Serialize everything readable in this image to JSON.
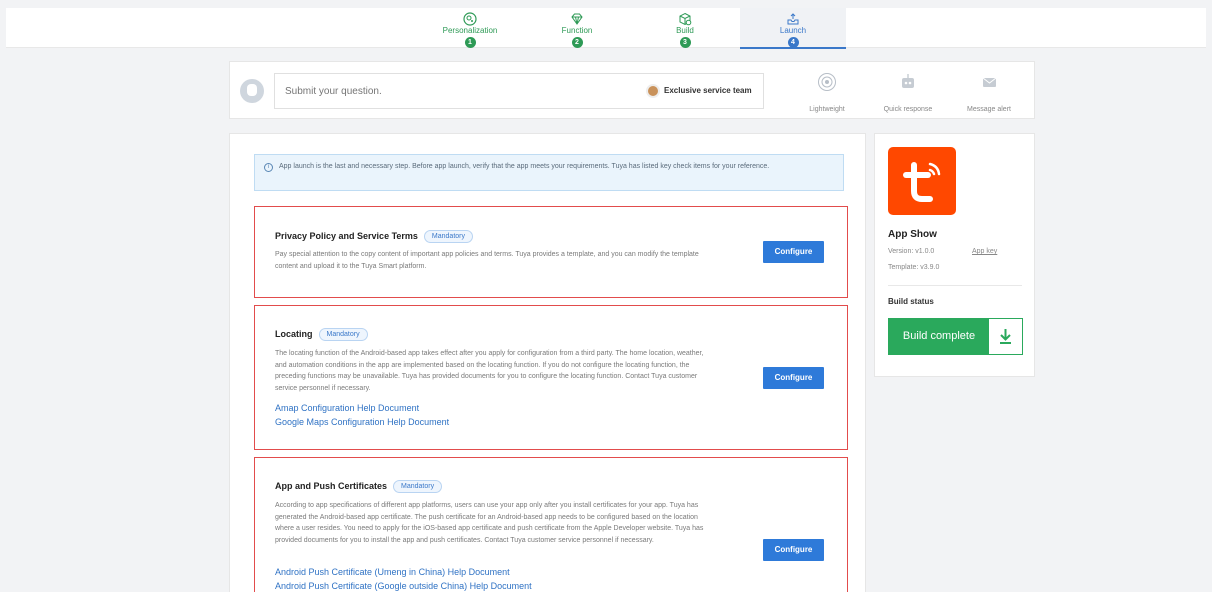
{
  "stepper": {
    "steps": [
      {
        "label": "Personalization",
        "number": "1",
        "icon": "palette-icon",
        "state": "done"
      },
      {
        "label": "Function",
        "number": "2",
        "icon": "diamond-icon",
        "state": "done"
      },
      {
        "label": "Build",
        "number": "3",
        "icon": "cube-icon",
        "state": "done"
      },
      {
        "label": "Launch",
        "number": "4",
        "icon": "inbox-upload-icon",
        "state": "active"
      }
    ]
  },
  "question_bar": {
    "placeholder": "Submit your question.",
    "exclusive_label": "Exclusive service team",
    "features": [
      {
        "label": "Lightweight",
        "icon": "target-icon"
      },
      {
        "label": "Quick response",
        "icon": "robot-icon"
      },
      {
        "label": "Message alert",
        "icon": "mail-icon"
      }
    ]
  },
  "notice": {
    "text": "App launch is the last and necessary step. Before app launch, verify that the app meets your requirements. Tuya has listed key check items for your reference."
  },
  "cards": [
    {
      "title": "Privacy Policy and Service Terms",
      "badge": "Mandatory",
      "description": "Pay special attention to the copy content of important app policies and terms. Tuya provides a template, and you can modify the template content and upload it to the Tuya Smart platform.",
      "button": "Configure",
      "links": []
    },
    {
      "title": "Locating",
      "badge": "Mandatory",
      "description": "The locating function of the Android-based app takes effect after you apply for configuration from a third party. The home location, weather, and automation conditions in the app are implemented based on the locating function. If you do not configure the locating function, the preceding functions may be unavailable. Tuya has provided documents for you to configure the locating function. Contact Tuya customer service personnel if necessary.",
      "button": "Configure",
      "links": [
        "Amap Configuration Help Document",
        "Google Maps Configuration Help Document"
      ]
    },
    {
      "title": "App and Push Certificates",
      "badge": "Mandatory",
      "description": "According to app specifications of different app platforms, users can use your app only after you install certificates for your app. Tuya has generated the Android-based app certificate. The push certificate for an Android-based app needs to be configured based on the location where a user resides. You need to apply for the iOS-based app certificate and push certificate from the Apple Developer website. Tuya has provided documents for you to install the app and push certificates. Contact Tuya customer service personnel if necessary.",
      "button": "Configure",
      "links": [
        "Android Push Certificate (Umeng in China) Help Document",
        "Android Push Certificate (Google outside China) Help Document"
      ]
    }
  ],
  "side": {
    "app_name": "App Show",
    "version": "Version: v1.0.0",
    "app_key": "App key",
    "template": "Template: v3.9.0",
    "build_status_label": "Build status",
    "build_button": "Build complete"
  },
  "colors": {
    "accent_blue": "#2e7ad9",
    "success_green": "#2aa95c",
    "mandatory_border": "#e24c4c",
    "logo_orange": "#ff4800"
  }
}
